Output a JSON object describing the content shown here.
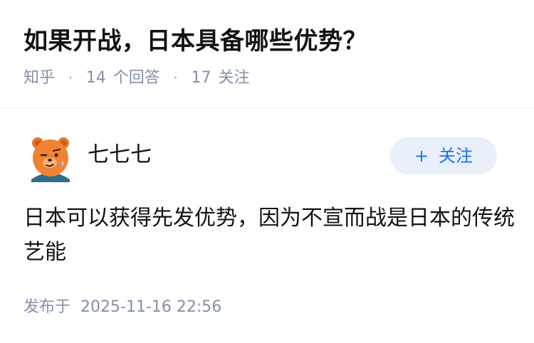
{
  "question": {
    "title": "如果开战，日本具备哪些优势？",
    "source": "知乎",
    "answers_count": "14",
    "answers_label": "个回答",
    "followers_count": "17",
    "followers_label": "关注"
  },
  "answer": {
    "author_name": "七七七",
    "avatar_icon": "bear-avatar-icon",
    "follow_button_label": "关注",
    "content": "日本可以获得先发优势，因为不宣而战是日本的传统艺能",
    "published_label": "发布于",
    "published_time": "2025-11-16 22:56"
  },
  "colors": {
    "primary": "#1772f6",
    "meta_text": "#8590a6",
    "follow_bg": "#e9f0fa",
    "text": "#121212"
  }
}
